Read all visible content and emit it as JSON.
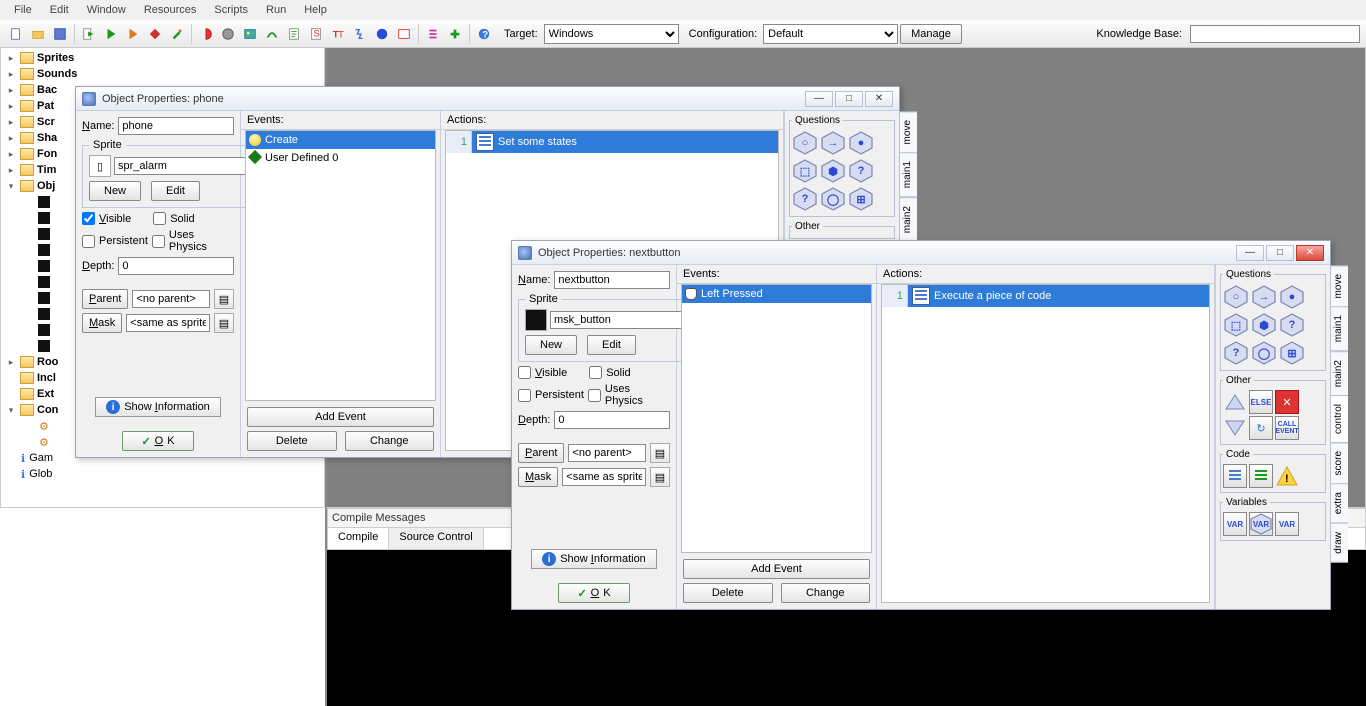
{
  "menu": {
    "items": [
      "File",
      "Edit",
      "Window",
      "Resources",
      "Scripts",
      "Run",
      "Help"
    ]
  },
  "toolbar": {
    "target_label": "Target:",
    "target_value": "Windows",
    "config_label": "Configuration:",
    "config_value": "Default",
    "manage": "Manage",
    "kb_label": "Knowledge Base:",
    "kb_value": ""
  },
  "tree": {
    "items": [
      {
        "icon": "folder",
        "label": "Sprites",
        "exp": "▸"
      },
      {
        "icon": "folder",
        "label": "Sounds",
        "exp": "▸"
      },
      {
        "icon": "folder",
        "label": "Bac",
        "exp": "▸"
      },
      {
        "icon": "folder",
        "label": "Pat",
        "exp": "▸"
      },
      {
        "icon": "folder",
        "label": "Scr",
        "exp": "▸"
      },
      {
        "icon": "folder",
        "label": "Sha",
        "exp": "▸"
      },
      {
        "icon": "folder",
        "label": "Fon",
        "exp": "▸"
      },
      {
        "icon": "folder",
        "label": "Tim",
        "exp": "▸"
      },
      {
        "icon": "folder",
        "label": "Obj",
        "exp": "▾"
      },
      {
        "icon": "obj",
        "label": "",
        "indent": 1
      },
      {
        "icon": "obj",
        "label": "",
        "indent": 1
      },
      {
        "icon": "obj",
        "label": "",
        "indent": 1
      },
      {
        "icon": "obj",
        "label": "",
        "indent": 1
      },
      {
        "icon": "obj",
        "label": "",
        "indent": 1
      },
      {
        "icon": "obj",
        "label": "",
        "indent": 1
      },
      {
        "icon": "obj",
        "label": "",
        "indent": 1
      },
      {
        "icon": "obj",
        "label": "",
        "indent": 1
      },
      {
        "icon": "obj",
        "label": "",
        "indent": 1
      },
      {
        "icon": "obj",
        "label": "",
        "indent": 1
      },
      {
        "icon": "folder",
        "label": "Roo",
        "exp": "▸"
      },
      {
        "icon": "folder",
        "label": "Incl",
        "exp": " "
      },
      {
        "icon": "folder",
        "label": "Ext",
        "exp": " "
      },
      {
        "icon": "folder",
        "label": "Con",
        "exp": "▾"
      },
      {
        "icon": "gear",
        "label": "",
        "indent": 1
      },
      {
        "icon": "gear",
        "label": "",
        "indent": 1
      },
      {
        "icon": "sub",
        "label": "Gam",
        "indent": 0
      },
      {
        "icon": "sub",
        "label": "Glob",
        "indent": 0
      }
    ]
  },
  "compile": {
    "header": "Compile Messages",
    "tabs": [
      "Compile",
      "Source Control"
    ]
  },
  "win1": {
    "title": "Object Properties: phone",
    "name_label": "Name:",
    "name": "phone",
    "sprite_legend": "Sprite",
    "sprite": "spr_alarm",
    "new": "New",
    "edit": "Edit",
    "visible": "Visible",
    "visible_checked": true,
    "solid": "Solid",
    "solid_checked": false,
    "persistent": "Persistent",
    "persistent_checked": false,
    "uses_physics": "Uses Physics",
    "uses_physics_checked": false,
    "depth_label": "Depth:",
    "depth": "0",
    "parent_btn": "Parent",
    "parent": "<no parent>",
    "mask_btn": "Mask",
    "mask": "<same as sprite>",
    "show_info": "Show Information",
    "ok": "OK",
    "events_hdr": "Events:",
    "events": [
      {
        "icon": "bulb",
        "label": "Create",
        "sel": true
      },
      {
        "icon": "diamond",
        "label": "User Defined 0",
        "sel": false
      }
    ],
    "add_event": "Add Event",
    "delete": "Delete",
    "change": "Change",
    "actions_hdr": "Actions:",
    "actions": [
      {
        "n": "1",
        "label": "Set some states"
      }
    ],
    "pal": {
      "questions": "Questions",
      "other": "Other"
    },
    "tabs": [
      "move",
      "main1",
      "main2"
    ]
  },
  "win2": {
    "title": "Object Properties: nextbutton",
    "name_label": "Name:",
    "name": "nextbutton",
    "sprite_legend": "Sprite",
    "sprite": "msk_button",
    "new": "New",
    "edit": "Edit",
    "visible": "Visible",
    "visible_checked": false,
    "solid": "Solid",
    "solid_checked": false,
    "persistent": "Persistent",
    "persistent_checked": false,
    "uses_physics": "Uses Physics",
    "uses_physics_checked": false,
    "depth_label": "Depth:",
    "depth": "0",
    "parent_btn": "Parent",
    "parent": "<no parent>",
    "mask_btn": "Mask",
    "mask": "<same as sprite>",
    "show_info": "Show Information",
    "ok": "OK",
    "events_hdr": "Events:",
    "events": [
      {
        "icon": "mouse",
        "label": "Left Pressed",
        "sel": true
      }
    ],
    "add_event": "Add Event",
    "delete": "Delete",
    "change": "Change",
    "actions_hdr": "Actions:",
    "actions": [
      {
        "n": "1",
        "label": "Execute a piece of code"
      }
    ],
    "pal": {
      "questions": "Questions",
      "other": "Other",
      "code": "Code",
      "variables": "Variables"
    },
    "tabs": [
      "move",
      "main1",
      "main2",
      "control",
      "score",
      "extra",
      "draw"
    ]
  }
}
